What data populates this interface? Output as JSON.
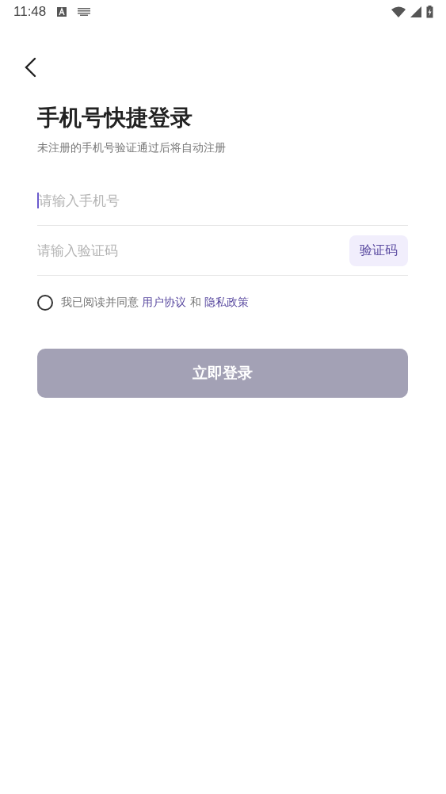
{
  "status_bar": {
    "time": "11:48"
  },
  "title": "手机号快捷登录",
  "subtitle": "未注册的手机号验证通过后将自动注册",
  "phone_field": {
    "placeholder": "请输入手机号",
    "focused": true
  },
  "code_field": {
    "placeholder": "请输入验证码",
    "button": "验证码"
  },
  "agreement": {
    "checked": false,
    "prefix": "我已阅读并同意",
    "link_1": "用户协议",
    "conjunction": "和",
    "link_2": "隐私政策"
  },
  "login_button": {
    "label": "立即登录",
    "disabled": true
  }
}
